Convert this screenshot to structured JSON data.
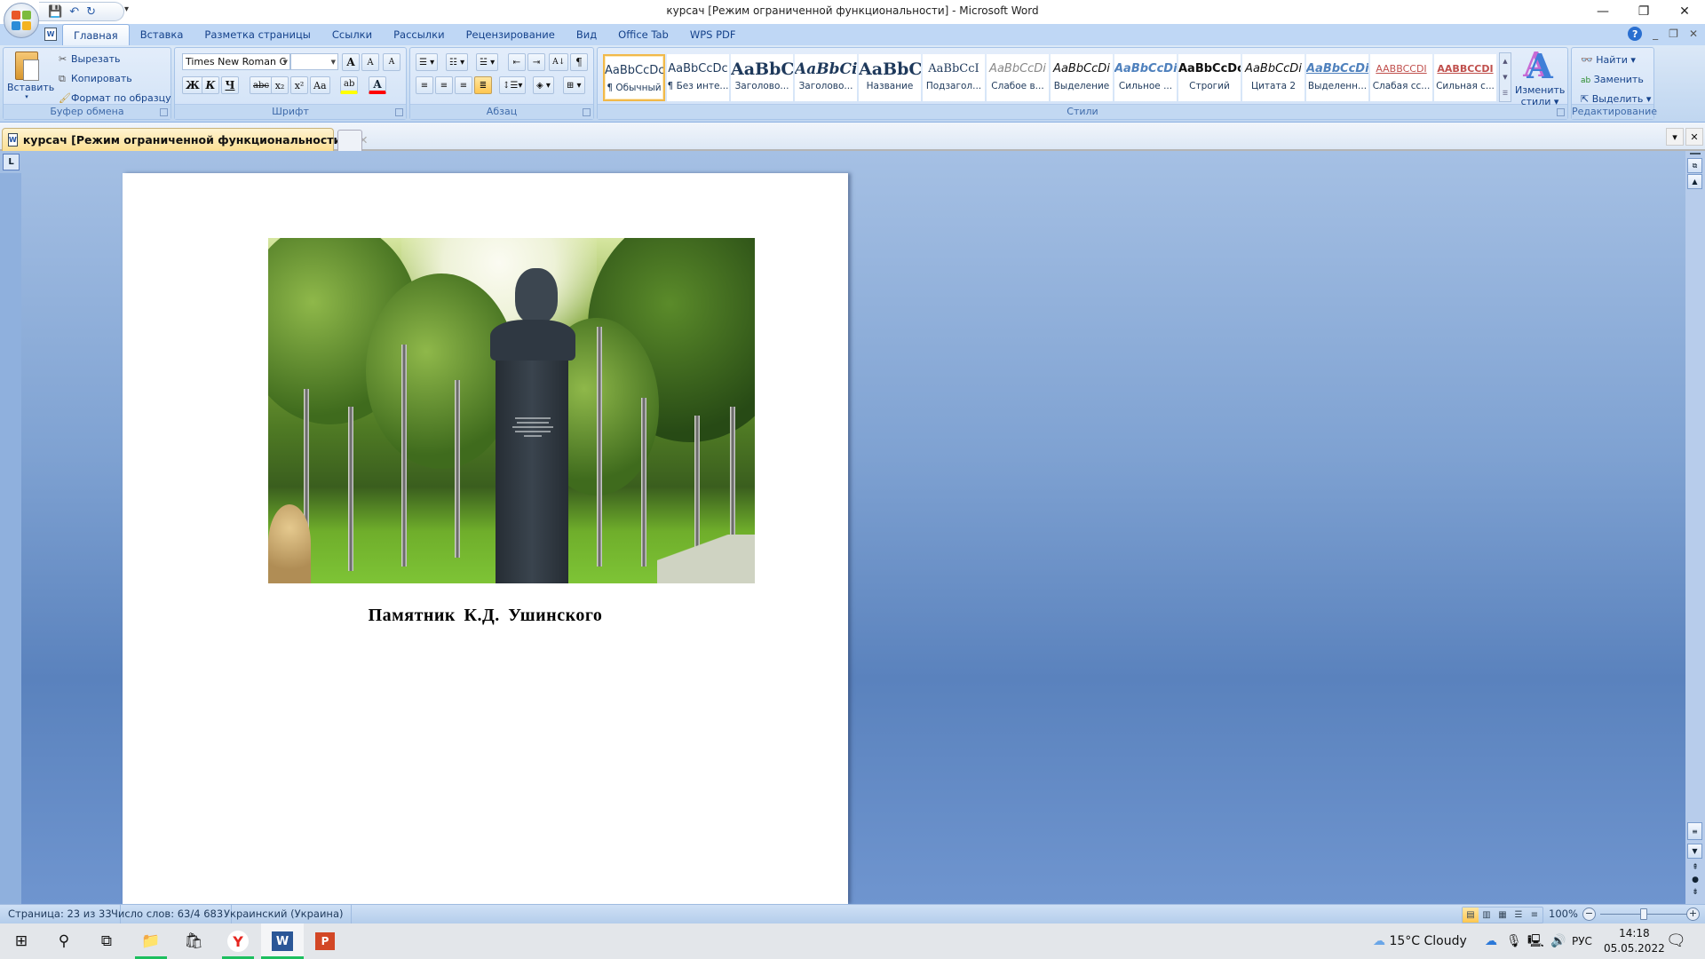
{
  "window": {
    "title": "курсач [Режим ограниченной функциональности] - Microsoft Word",
    "controls": {
      "minimize": "—",
      "restore": "❐",
      "close": "✕"
    }
  },
  "quick_access": {
    "save_icon": "save-icon",
    "undo_icon": "undo-icon",
    "redo_icon": "redo-icon",
    "customize": "▾"
  },
  "ribbon": {
    "tabs": [
      {
        "label": "Главная",
        "active": true
      },
      {
        "label": "Вставка"
      },
      {
        "label": "Разметка страницы"
      },
      {
        "label": "Ссылки"
      },
      {
        "label": "Рассылки"
      },
      {
        "label": "Рецензирование"
      },
      {
        "label": "Вид"
      },
      {
        "label": "Office Tab"
      },
      {
        "label": "WPS PDF"
      }
    ],
    "clipboard": {
      "label": "Буфер обмена",
      "paste": "Вставить",
      "cut": "Вырезать",
      "copy": "Копировать",
      "format_painter": "Формат по образцу"
    },
    "font": {
      "label": "Шрифт",
      "font_name": "Times New Roman C",
      "font_size": "",
      "bold": "Ж",
      "italic": "К",
      "underline": "Ч",
      "strike": "abc",
      "subscript": "x₂",
      "superscript": "x²",
      "change_case": "Aa",
      "grow": "A",
      "shrink": "A",
      "clear": "A",
      "highlight_color": "#ffff00",
      "font_color": "#ff0000"
    },
    "paragraph": {
      "label": "Абзац",
      "pilcrow": "¶",
      "sort": "А↓"
    },
    "styles": {
      "label": "Стили",
      "items": [
        {
          "sample": "AaBbCcDc",
          "name": "¶ Обычный",
          "selected": true
        },
        {
          "sample": "AaBbCcDc",
          "name": "¶ Без инте..."
        },
        {
          "sample": "AaBbC",
          "name": "Заголово..."
        },
        {
          "sample": "AaBbCi",
          "name": "Заголово..."
        },
        {
          "sample": "AaBbC",
          "name": "Название"
        },
        {
          "sample": "AaBbCcI",
          "name": "Подзагол..."
        },
        {
          "sample": "AaBbCcDi",
          "name": "Слабое в..."
        },
        {
          "sample": "AaBbCcDi",
          "name": "Выделение"
        },
        {
          "sample": "AaBbCcDi",
          "name": "Сильное ..."
        },
        {
          "sample": "AaBbCcDc",
          "name": "Строгий"
        },
        {
          "sample": "AaBbCcDi",
          "name": "Цитата 2"
        },
        {
          "sample": "AaBbCcDi",
          "name": "Выделенн..."
        },
        {
          "sample": "AABBCCDI",
          "name": "Слабая сс..."
        },
        {
          "sample": "AABBCCDI",
          "name": "Сильная с..."
        }
      ],
      "change_styles_line1": "Изменить",
      "change_styles_line2": "стили ▾"
    },
    "editing": {
      "label": "Редактирование",
      "find": "Найти ▾",
      "replace": "Заменить",
      "select": "Выделить ▾"
    }
  },
  "doc_tabs": {
    "active_tab": "курсач [Режим ограниченной функциональности]",
    "close": "✕",
    "menu": "▾",
    "close_all": "✕"
  },
  "document": {
    "image_description": "Photo of a monument bust on a tall pedestal among birch trees in a park",
    "caption": "Памятник  К.Д.  Ушинского"
  },
  "status_bar": {
    "page": "Страница: 23 из 33",
    "words": "Число слов: 63/4 683",
    "language": "Украинский (Украина)",
    "zoom": "100%",
    "zoom_level_percent": 100
  },
  "taskbar": {
    "apps": [
      {
        "name": "start",
        "glyph": "⊞"
      },
      {
        "name": "search",
        "glyph": "⚲"
      },
      {
        "name": "task-view",
        "glyph": "⧉"
      },
      {
        "name": "file-explorer",
        "glyph": "📁",
        "running": true
      },
      {
        "name": "store",
        "glyph": "🛍"
      },
      {
        "name": "yandex-browser",
        "glyph": "Y",
        "running": true
      },
      {
        "name": "word",
        "glyph": "W",
        "running": true,
        "active": true
      },
      {
        "name": "powerpoint",
        "glyph": "P"
      }
    ],
    "weather": "15°C  Cloudy",
    "language": "РУС",
    "time": "14:18",
    "date": "05.05.2022"
  }
}
